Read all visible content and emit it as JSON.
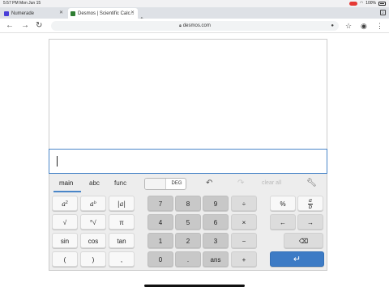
{
  "statusbar": {
    "time": "5:57 PM",
    "date": "Mon Jun 15",
    "battery": "100%"
  },
  "tabs": [
    {
      "title": "Numerade",
      "favicon_color": "#4a3fd8"
    },
    {
      "title": "Desmos | Scientific Calc...",
      "favicon_color": "#2e7d32"
    }
  ],
  "tab_count": "2",
  "address": {
    "url": "desmos.com"
  },
  "keypad": {
    "tabs": [
      "main",
      "abc",
      "func"
    ],
    "active_tab": "main",
    "angle_mode": "DEG",
    "clear_all": "clear all",
    "keys": {
      "a2_base": "a",
      "a2_exp": "2",
      "ab_base": "a",
      "ab_exp": "b",
      "abs": "|a|",
      "sqrt": "√",
      "nroot_index": "n",
      "nroot": "√",
      "pi": "π",
      "sin": "sin",
      "cos": "cos",
      "tan": "tan",
      "lparen": "(",
      "rparen": ")",
      "comma": ",",
      "d7": "7",
      "d8": "8",
      "d9": "9",
      "div": "÷",
      "d4": "4",
      "d5": "5",
      "d6": "6",
      "mul": "×",
      "d1": "1",
      "d2": "2",
      "d3": "3",
      "minus": "−",
      "d0": "0",
      "dot": ".",
      "ans": "ans",
      "plus": "+",
      "percent": "%",
      "frac_num": "a",
      "frac_den": "b",
      "left": "←",
      "right": "→",
      "backspace": "⌫",
      "enter": "↵"
    }
  }
}
